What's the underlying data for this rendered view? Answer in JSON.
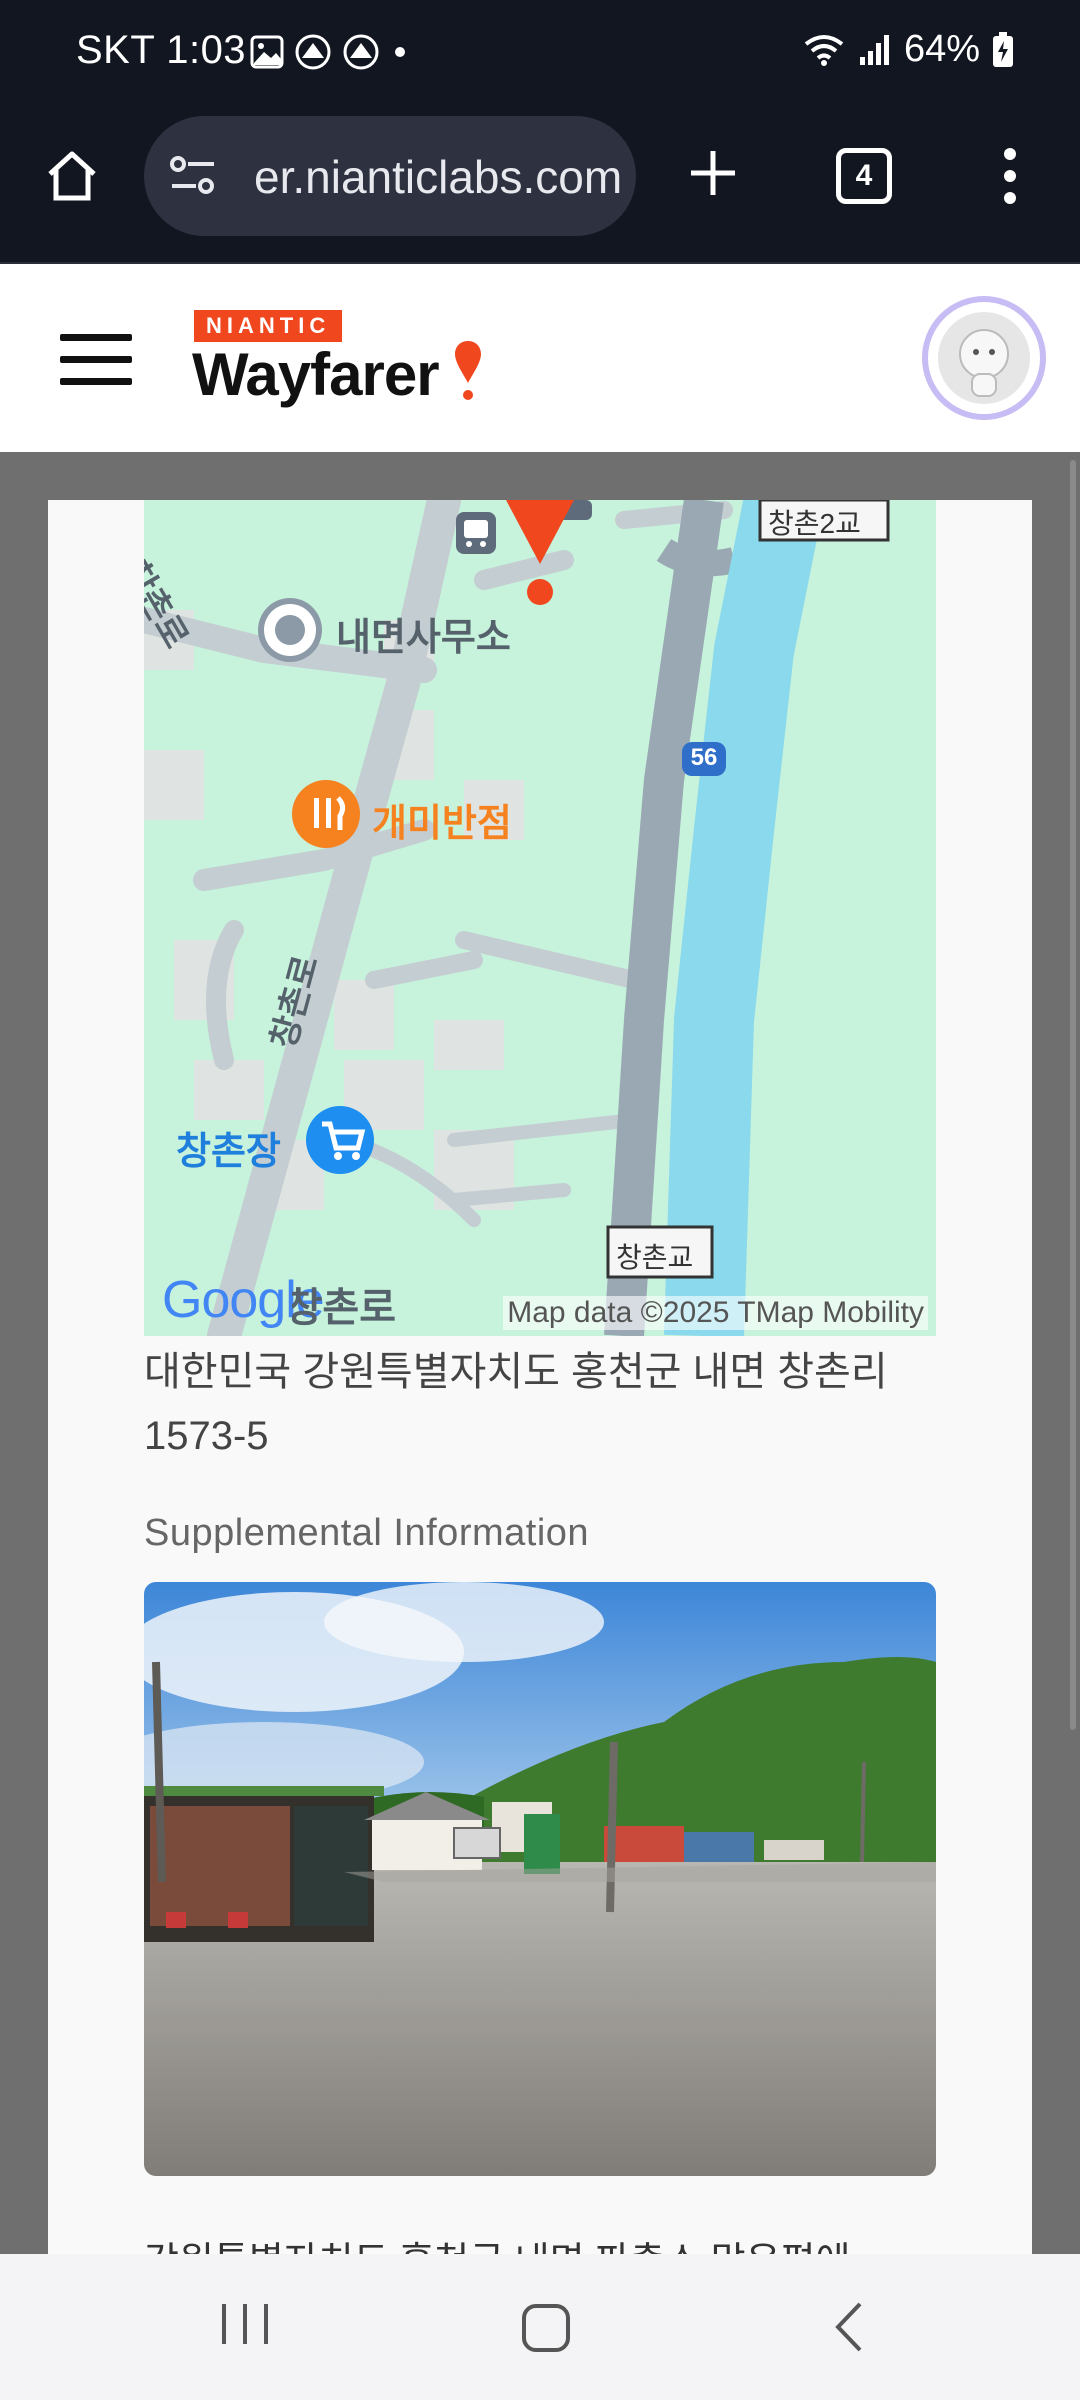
{
  "status_bar": {
    "carrier": "SKT",
    "time": "1:03",
    "battery": "64%"
  },
  "browser": {
    "url": "er.nianticlabs.com",
    "tab_count": "4"
  },
  "site": {
    "brand_small": "NIANTIC",
    "brand_name": "Wayfarer"
  },
  "map": {
    "labels": {
      "office": "내면사무소",
      "restaurant": "개미반점",
      "market": "창촌장",
      "bridge_top": "창촌2교",
      "bridge_bottom": "창촌교",
      "road_vertical": "창촌로",
      "road_top_left": "창촌로",
      "road_bottom": "창촌로",
      "route": "56"
    },
    "logo": "Google",
    "attribution": "Map data ©2025 TMap Mobility"
  },
  "address": "대한민국 강원특별자치도 홍천군 내면 창촌리 1573-5",
  "supplemental_heading": "Supplemental Information",
  "description_partial": "강원특별자치도 홍천군 내면 파출소 맞은편에"
}
